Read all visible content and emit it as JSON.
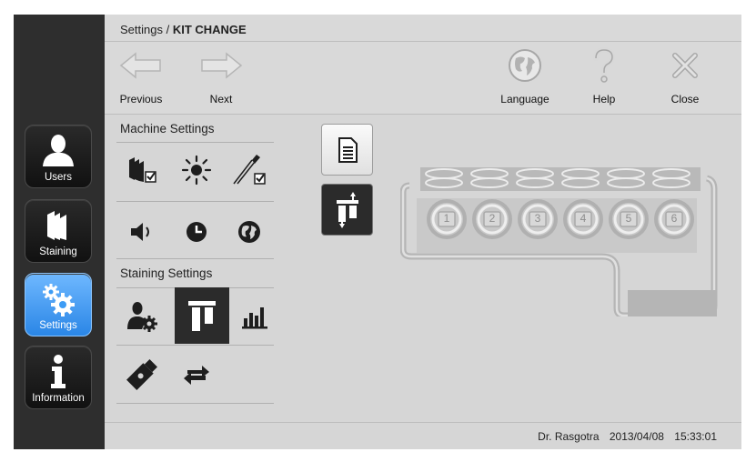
{
  "breadcrumb": {
    "parent": "Settings /",
    "current": "KIT CHANGE"
  },
  "toolbar": {
    "previous_label": "Previous",
    "next_label": "Next",
    "language_label": "Language",
    "help_label": "Help",
    "close_label": "Close"
  },
  "nav": [
    {
      "label": "Users",
      "icon": "user-icon"
    },
    {
      "label": "Staining",
      "icon": "staining-icon"
    },
    {
      "label": "Settings",
      "icon": "gears-icon",
      "active": true
    },
    {
      "label": "Information",
      "icon": "info-icon"
    }
  ],
  "sections": {
    "machine": "Machine Settings",
    "staining": "Staining Settings"
  },
  "kit": {
    "slots": [
      "1",
      "2",
      "3",
      "4",
      "5",
      "6"
    ]
  },
  "status": {
    "user": "Dr. Rasgotra",
    "date": "2013/04/08",
    "time": "15:33:01"
  },
  "colors": {
    "nav_active": "#3d9cf5",
    "background": "#d6d6d6",
    "nav_background": "#2e2e2e"
  }
}
